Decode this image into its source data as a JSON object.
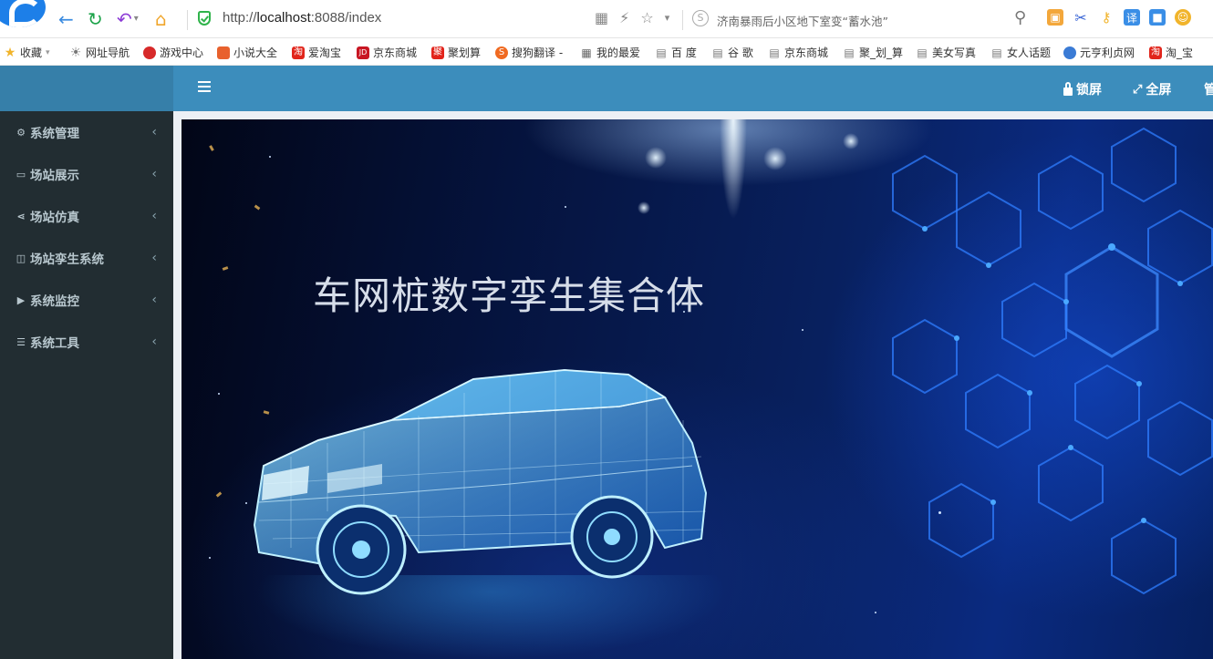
{
  "browser": {
    "url_prefix": "http://",
    "url_host": "localhost",
    "url_rest": ":8088/index",
    "search_text": "济南暴雨后小区地下室变“蓄水池”"
  },
  "bookmarks": [
    {
      "label": "收藏",
      "icon": "star-icon",
      "color": "#f1b42b"
    },
    {
      "label": "网址导航",
      "icon": "globe-icon",
      "color": "#777777"
    },
    {
      "label": "游戏中心",
      "icon": "game-icon",
      "color": "#d72a2a"
    },
    {
      "label": "小说大全",
      "icon": "book-icon",
      "color": "#e8612d"
    },
    {
      "label": "爱淘宝",
      "icon": "taobao-icon",
      "color": "#e1251b"
    },
    {
      "label": "京东商城",
      "icon": "jd-icon",
      "color": "#c81623"
    },
    {
      "label": "聚划算",
      "icon": "juhuasuan-icon",
      "color": "#e2231a"
    },
    {
      "label": "搜狗翻译 -",
      "icon": "sogou-icon",
      "color": "#f06a21"
    },
    {
      "label": "我的最爱",
      "icon": "grid-icon",
      "color": "#666666"
    },
    {
      "label": "百 度",
      "icon": "page-icon",
      "color": "#777777"
    },
    {
      "label": "谷 歌",
      "icon": "page-icon",
      "color": "#777777"
    },
    {
      "label": "京东商城",
      "icon": "page-icon",
      "color": "#777777"
    },
    {
      "label": "聚_划_算",
      "icon": "page-icon",
      "color": "#777777"
    },
    {
      "label": "美女写真",
      "icon": "page-icon",
      "color": "#777777"
    },
    {
      "label": "女人话题",
      "icon": "page-icon",
      "color": "#777777"
    },
    {
      "label": "元亨利贞网",
      "icon": "yuanheng-icon",
      "color": "#3a7bd5"
    },
    {
      "label": "淘_宝",
      "icon": "taobao-icon",
      "color": "#e1251b"
    }
  ],
  "header": {
    "lock_label": "锁屏",
    "fullscreen_label": "全屏",
    "admin_label": "管"
  },
  "sidebar": {
    "items": [
      {
        "label": "系统管理",
        "icon": "gear-icon"
      },
      {
        "label": "场站展示",
        "icon": "monitor-icon"
      },
      {
        "label": "场站仿真",
        "icon": "share-icon"
      },
      {
        "label": "场站孪生系统",
        "icon": "sitemap-icon"
      },
      {
        "label": "系统监控",
        "icon": "video-icon"
      },
      {
        "label": "系统工具",
        "icon": "bars-icon"
      }
    ]
  },
  "banner": {
    "title": "车网桩数字孪生集合体"
  },
  "colors": {
    "header": "#3c8dbc",
    "sidebar": "#222d32",
    "sidebar_text": "#b8c7ce"
  }
}
